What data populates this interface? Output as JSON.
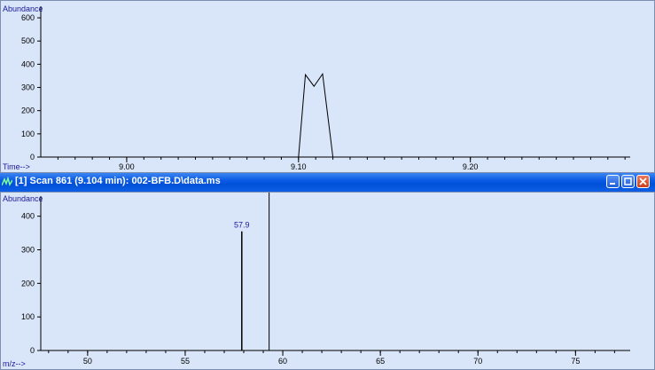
{
  "tic": {
    "y_title": "Abundance",
    "x_title": "Time-->",
    "y_ticks": [
      "600",
      "500",
      "400",
      "300",
      "200",
      "100",
      "0"
    ],
    "x_ticks": [
      "9.00",
      "9.10",
      "9.20"
    ]
  },
  "spectrum_window": {
    "title": "[1] Scan 861 (9.104 min): 002-BFB.D\\data.ms",
    "y_title": "Abundance",
    "x_title": "m/z-->",
    "y_ticks": [
      "400",
      "300",
      "200",
      "100",
      "0"
    ],
    "x_ticks": [
      "50",
      "55",
      "60",
      "65",
      "70",
      "75"
    ],
    "peak_label": "57.9"
  },
  "chart_data": [
    {
      "type": "line",
      "xlabel": "Time-->",
      "ylabel": "Abundance",
      "x_ticks": [
        9.0,
        9.1,
        9.2
      ],
      "y_ticks": [
        0,
        100,
        200,
        300,
        400,
        500,
        600
      ],
      "ylim": [
        0,
        650
      ],
      "series": [
        {
          "x": [
            9.1,
            9.104,
            9.109,
            9.114,
            9.12
          ],
          "y": [
            0,
            355,
            305,
            358,
            0
          ]
        }
      ]
    },
    {
      "type": "bar",
      "xlabel": "m/z-->",
      "ylabel": "Abundance",
      "x_ticks": [
        50,
        55,
        60,
        65,
        70,
        75
      ],
      "y_ticks": [
        0,
        100,
        200,
        300,
        400
      ],
      "ylim": [
        0,
        460
      ],
      "series": [
        {
          "x": [
            57.9
          ],
          "y": [
            355
          ],
          "labels": [
            "57.9"
          ]
        }
      ],
      "cursor_x": 59.3
    }
  ],
  "colors": {
    "plot_bg": "#d9e5f8",
    "label_blue": "#1a1a9a",
    "titlebar": "#0a5ae6"
  }
}
